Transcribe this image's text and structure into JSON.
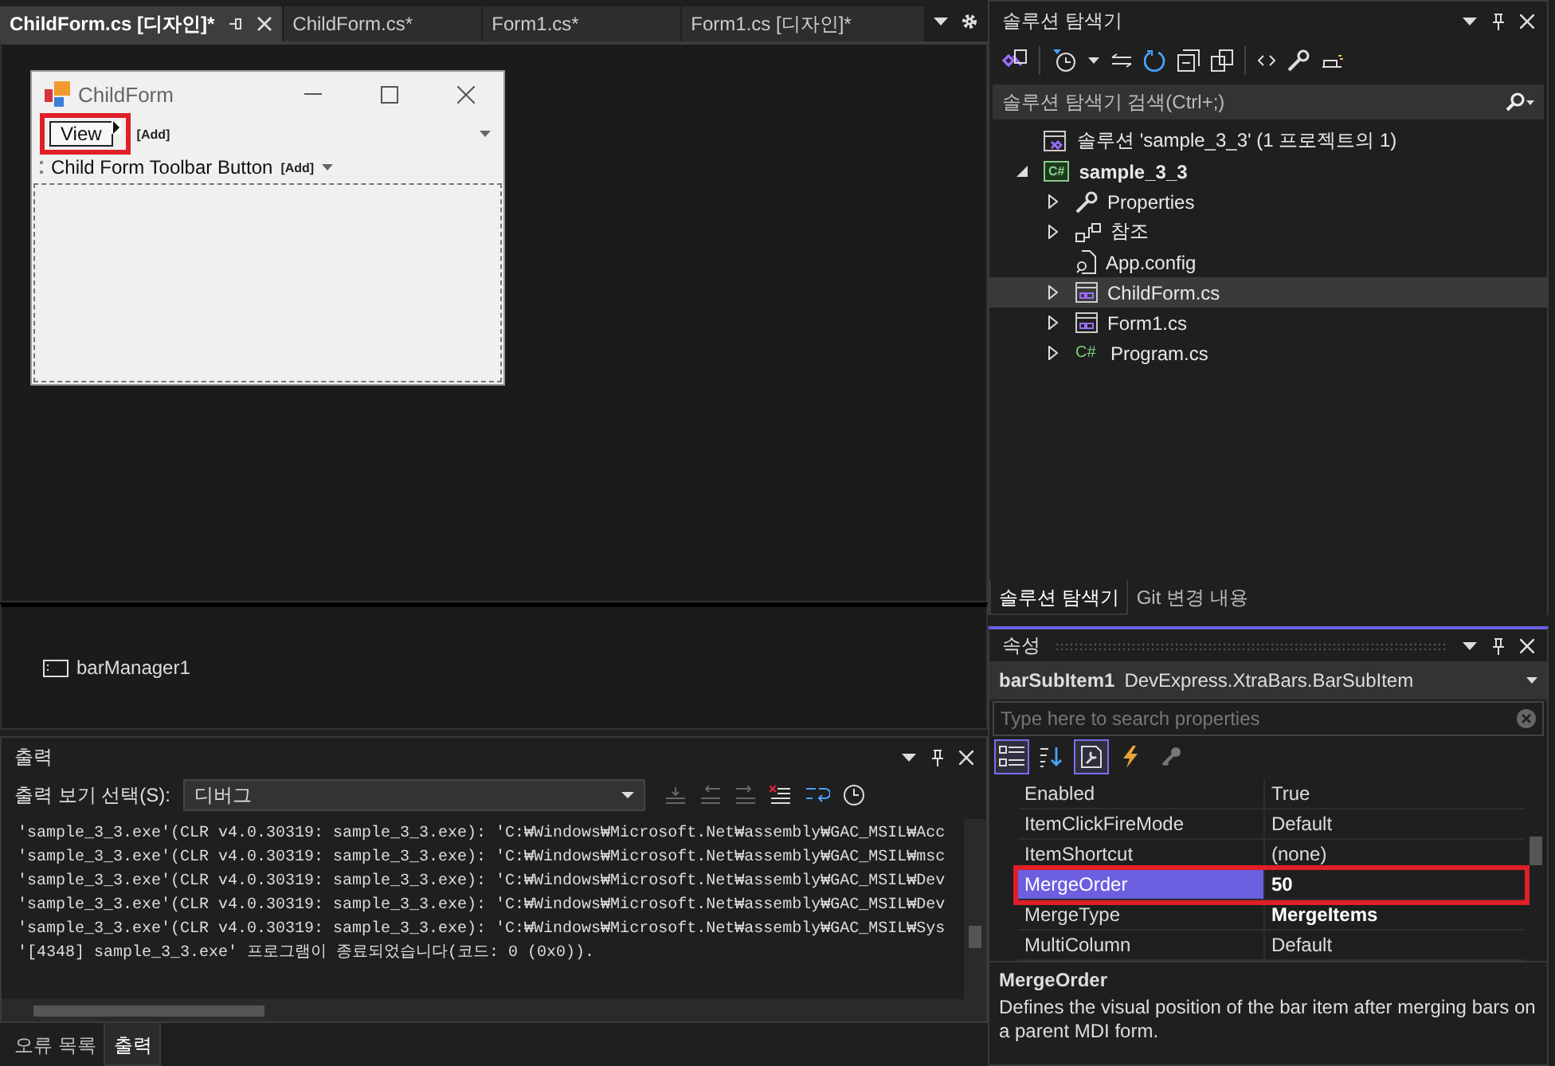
{
  "document_tabs": [
    {
      "label": "ChildForm.cs [디자인]*",
      "selected": true
    },
    {
      "label": "ChildForm.cs*",
      "selected": false
    },
    {
      "label": "Form1.cs*",
      "selected": false
    },
    {
      "label": "Form1.cs [디자인]*",
      "selected": false
    }
  ],
  "designer": {
    "form_title": "ChildForm",
    "menu_item": "View",
    "menu_add": "[Add]",
    "toolbar_button": "Child Form Toolbar Button",
    "toolbar_add": "[Add]",
    "menu_item_highlighted": true
  },
  "component_tray": {
    "component": "barManager1"
  },
  "output": {
    "title": "출력",
    "source_label": "출력 보기 선택(S):",
    "source_value": "디버그",
    "lines": [
      "'sample_3_3.exe'(CLR v4.0.30319: sample_3_3.exe): 'C:₩Windows₩Microsoft.Net₩assembly₩GAC_MSIL₩Acc",
      "'sample_3_3.exe'(CLR v4.0.30319: sample_3_3.exe): 'C:₩Windows₩Microsoft.Net₩assembly₩GAC_MSIL₩msc",
      "'sample_3_3.exe'(CLR v4.0.30319: sample_3_3.exe): 'C:₩Windows₩Microsoft.Net₩assembly₩GAC_MSIL₩Dev",
      "'sample_3_3.exe'(CLR v4.0.30319: sample_3_3.exe): 'C:₩Windows₩Microsoft.Net₩assembly₩GAC_MSIL₩Dev",
      "'sample_3_3.exe'(CLR v4.0.30319: sample_3_3.exe): 'C:₩Windows₩Microsoft.Net₩assembly₩GAC_MSIL₩Sys",
      "'[4348] sample_3_3.exe' 프로그램이 종료되었습니다(코드: 0 (0x0))."
    ]
  },
  "bottom_tabs": [
    {
      "label": "오류 목록",
      "selected": false
    },
    {
      "label": "출력",
      "selected": true
    }
  ],
  "solution_explorer": {
    "title": "솔루션 탐색기",
    "search_placeholder": "솔루션 탐색기 검색(Ctrl+;)",
    "tree": [
      {
        "label": "솔루션 'sample_3_3'  (1 프로젝트의 1)",
        "kind": "solution",
        "selected": false,
        "children": [
          {
            "label": "sample_3_3",
            "kind": "project",
            "icon_text": "C#",
            "expanded": true,
            "selected": false,
            "children": [
              {
                "label": "Properties",
                "kind": "properties",
                "expanded": false,
                "selected": false
              },
              {
                "label": "참조",
                "kind": "references",
                "expanded": false,
                "selected": false
              },
              {
                "label": "App.config",
                "kind": "config",
                "selected": false
              },
              {
                "label": "ChildForm.cs",
                "kind": "form",
                "expanded": false,
                "selected": true
              },
              {
                "label": "Form1.cs",
                "kind": "form",
                "expanded": false,
                "selected": false
              },
              {
                "label": "Program.cs",
                "kind": "csharp",
                "icon_text": "C#",
                "expanded": false,
                "selected": false
              }
            ]
          }
        ]
      }
    ],
    "tabs": [
      {
        "label": "솔루션 탐색기",
        "selected": true
      },
      {
        "label": "Git 변경 내용",
        "selected": false
      }
    ]
  },
  "properties": {
    "title": "속성",
    "object_name": "barSubItem1",
    "object_type": "DevExpress.XtraBars.BarSubItem",
    "search_placeholder": "Type here to search properties",
    "toolbar": [
      {
        "kind": "categorized",
        "on": true
      },
      {
        "kind": "alphabetical",
        "on": false
      },
      {
        "kind": "properties",
        "on": true
      },
      {
        "kind": "events",
        "on": false
      },
      {
        "kind": "property-pages",
        "on": false
      }
    ],
    "rows": [
      {
        "name": "Enabled",
        "value": "True",
        "selected": false,
        "bold": false
      },
      {
        "name": "ItemClickFireMode",
        "value": "Default",
        "selected": false,
        "bold": false
      },
      {
        "name": "ItemShortcut",
        "value": "(none)",
        "selected": false,
        "bold": false
      },
      {
        "name": "MergeOrder",
        "value": "50",
        "selected": true,
        "bold": true
      },
      {
        "name": "MergeType",
        "value": "MergeItems",
        "selected": false,
        "bold": true
      },
      {
        "name": "MultiColumn",
        "value": "Default",
        "selected": false,
        "bold": false
      }
    ],
    "description_title": "MergeOrder",
    "description": "Defines the visual position of the bar item after merging bars on a parent MDI form."
  }
}
